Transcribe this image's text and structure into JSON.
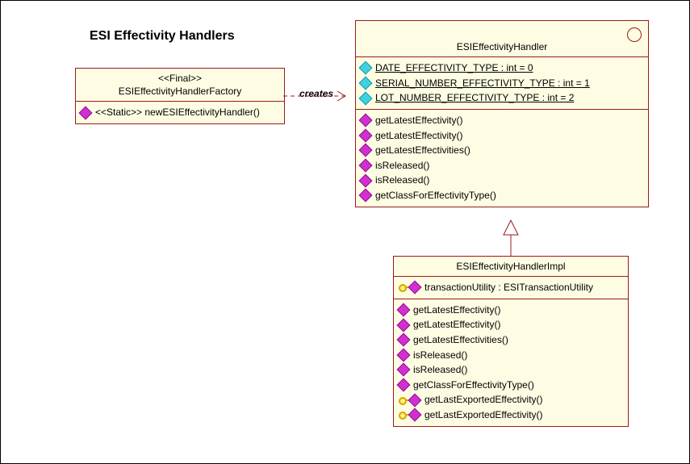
{
  "title": "ESI Effectivity Handlers",
  "creates_label": "creates",
  "factory": {
    "stereotype": "<<Final>>",
    "name": "ESIEffectivityHandlerFactory",
    "methods": [
      {
        "icon": "magenta",
        "text": "<<Static>> newESIEffectivityHandler()"
      }
    ]
  },
  "handler": {
    "name": "ESIEffectivityHandler",
    "attrs": [
      {
        "icon": "cyan",
        "text": "DATE_EFFECTIVITY_TYPE : int = 0",
        "underline": true
      },
      {
        "icon": "cyan",
        "text": "SERIAL_NUMBER_EFFECTIVITY_TYPE : int = 1",
        "underline": true
      },
      {
        "icon": "cyan",
        "text": "LOT_NUMBER_EFFECTIVITY_TYPE : int = 2",
        "underline": true
      }
    ],
    "methods": [
      {
        "icon": "magenta",
        "text": "getLatestEffectivity()"
      },
      {
        "icon": "magenta",
        "text": "getLatestEffectivity()"
      },
      {
        "icon": "magenta",
        "text": "getLatestEffectivities()"
      },
      {
        "icon": "magenta",
        "text": "isReleased()"
      },
      {
        "icon": "magenta",
        "text": "isReleased()"
      },
      {
        "icon": "magenta",
        "text": "getClassForEffectivityType()"
      }
    ]
  },
  "impl": {
    "name": "ESIEffectivityHandlerImpl",
    "attrs": [
      {
        "icon": "key-magenta",
        "text": "transactionUtility : ESITransactionUtility"
      }
    ],
    "methods": [
      {
        "icon": "magenta",
        "text": "getLatestEffectivity()"
      },
      {
        "icon": "magenta",
        "text": "getLatestEffectivity()"
      },
      {
        "icon": "magenta",
        "text": "getLatestEffectivities()"
      },
      {
        "icon": "magenta",
        "text": "isReleased()"
      },
      {
        "icon": "magenta",
        "text": "isReleased()"
      },
      {
        "icon": "magenta",
        "text": "getClassForEffectivityType()"
      },
      {
        "icon": "key-magenta",
        "text": "getLastExportedEffectivity()"
      },
      {
        "icon": "key-magenta",
        "text": "getLastExportedEffectivity()"
      }
    ]
  },
  "chart_data": {
    "type": "table",
    "description": "UML class diagram: ESIEffectivityHandlerFactory creates ESIEffectivityHandler; ESIEffectivityHandlerImpl realizes ESIEffectivityHandler.",
    "classes": [
      {
        "name": "ESIEffectivityHandlerFactory",
        "stereotype": "Final",
        "methods": [
          "<<Static>> newESIEffectivityHandler()"
        ]
      },
      {
        "name": "ESIEffectivityHandler",
        "attributes": [
          "DATE_EFFECTIVITY_TYPE : int = 0",
          "SERIAL_NUMBER_EFFECTIVITY_TYPE : int = 1",
          "LOT_NUMBER_EFFECTIVITY_TYPE : int = 2"
        ],
        "methods": [
          "getLatestEffectivity()",
          "getLatestEffectivity()",
          "getLatestEffectivities()",
          "isReleased()",
          "isReleased()",
          "getClassForEffectivityType()"
        ]
      },
      {
        "name": "ESIEffectivityHandlerImpl",
        "attributes": [
          "transactionUtility : ESITransactionUtility"
        ],
        "methods": [
          "getLatestEffectivity()",
          "getLatestEffectivity()",
          "getLatestEffectivities()",
          "isReleased()",
          "isReleased()",
          "getClassForEffectivityType()",
          "getLastExportedEffectivity()",
          "getLastExportedEffectivity()"
        ]
      }
    ],
    "relationships": [
      {
        "from": "ESIEffectivityHandlerFactory",
        "to": "ESIEffectivityHandler",
        "type": "dependency",
        "label": "creates"
      },
      {
        "from": "ESIEffectivityHandlerImpl",
        "to": "ESIEffectivityHandler",
        "type": "realization"
      }
    ]
  }
}
